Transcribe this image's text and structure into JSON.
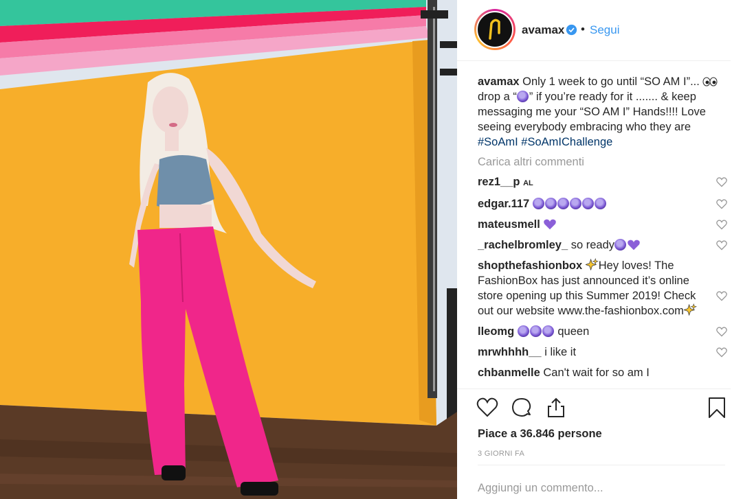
{
  "header": {
    "username": "avamax",
    "separator": "•",
    "follow_label": "Segui"
  },
  "caption": {
    "username": "avamax",
    "text_1": "Only 1 week to go until “SO AM I”...",
    "text_2": "drop a “",
    "text_3": "” if you’re ready for it ....... & keep messaging me your “SO AM I” Hands!!!! Love seeing everybody embracing who they are",
    "hashtag_1": "#SoAmI",
    "hashtag_2": "#SoAmIChallenge"
  },
  "load_more": "Carica altri commenti",
  "comments": [
    {
      "user": "rez1__p",
      "badge": "AL",
      "text": ""
    },
    {
      "user": "edgar.117",
      "text": ""
    },
    {
      "user": "mateusmell",
      "text": ""
    },
    {
      "user": "_rachelbromley_",
      "text": "so ready"
    },
    {
      "user": "shopthefashionbox",
      "text": "Hey loves! The FashionBox has just announced it’s online store opening up this Summer 2019! Check out our website www.the-fashionbox.com"
    },
    {
      "user": "lleomg",
      "text": "queen"
    },
    {
      "user": "mrwhhhh__",
      "text": "i like it"
    },
    {
      "user": "chbanmelle",
      "text": "Can't wait for so am I"
    }
  ],
  "likes_text": "Piace a 36.846 persone",
  "time_text": "3 GIORNI FA",
  "add_comment_placeholder": "Aggiungi un commento...",
  "icons": {
    "like": "heart-outline-icon",
    "comment": "speech-bubble-icon",
    "share": "share-upload-icon",
    "save": "bookmark-icon",
    "verified": "verified-badge-icon",
    "comment_like": "small-heart-icon"
  },
  "colors": {
    "link": "#3897f0",
    "hashtag": "#003569",
    "muted": "#999999",
    "backdrop": "#f7b02b",
    "pants": "#f0268a"
  }
}
